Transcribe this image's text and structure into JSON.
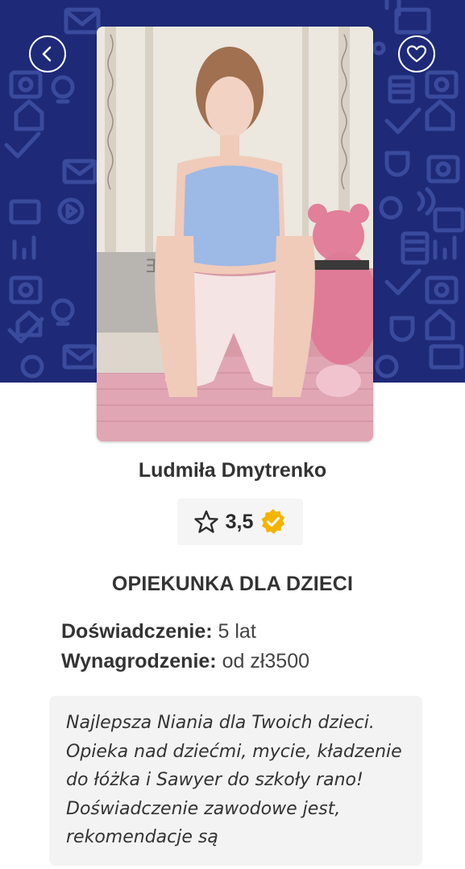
{
  "profile": {
    "name": "Ludmiła Dmytrenko",
    "rating": "3,5",
    "job_title": "OPIEKUNKA DLA DZIECI",
    "experience_label": "Doświadczenie:",
    "experience_value": "5 lat",
    "salary_label": "Wynagrodzenie:",
    "salary_value": "od zł3500",
    "description": "Najlepsza Niania dla Twoich dzieci. Opieka nad dziećmi, mycie, kładzenie do łóżka i Sawyer do szkoły rano! Doświadczenie zawodowe jest, rekomendacje są"
  },
  "icons": {
    "back": "chevron-left-icon",
    "favorite": "heart-icon",
    "rating_star": "star-outline-icon",
    "verified": "verified-badge-icon"
  },
  "colors": {
    "hero_background": "#1e2a78",
    "hero_pattern": "#3a4a9c",
    "verified_badge": "#f5b400",
    "card_background": "#f3f3f3"
  }
}
